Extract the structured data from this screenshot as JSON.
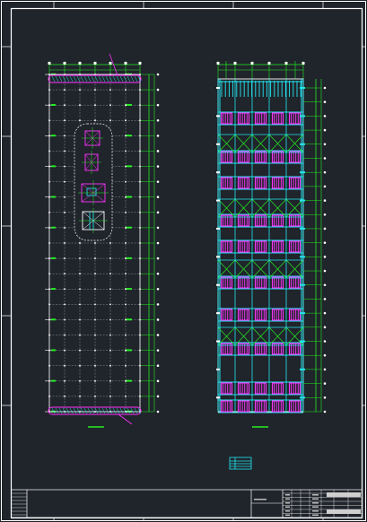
{
  "colors": {
    "background": "#20242b",
    "frame": "#ffffff",
    "grid": "#9aa0a6",
    "dimension": "#22ee22",
    "magenta": "#ff33ff",
    "cyan": "#22e6f0",
    "white": "#ffffff"
  },
  "drawing": {
    "left_plan": {
      "name": "floor-plan-grid",
      "bays": 6,
      "rows": 22,
      "core_elements": 4
    },
    "right_plan": {
      "name": "roof-framing-plan",
      "bays": 5,
      "magenta_bands": 10,
      "cross_braced_rows": 4
    }
  },
  "title_block": {
    "present": true
  }
}
